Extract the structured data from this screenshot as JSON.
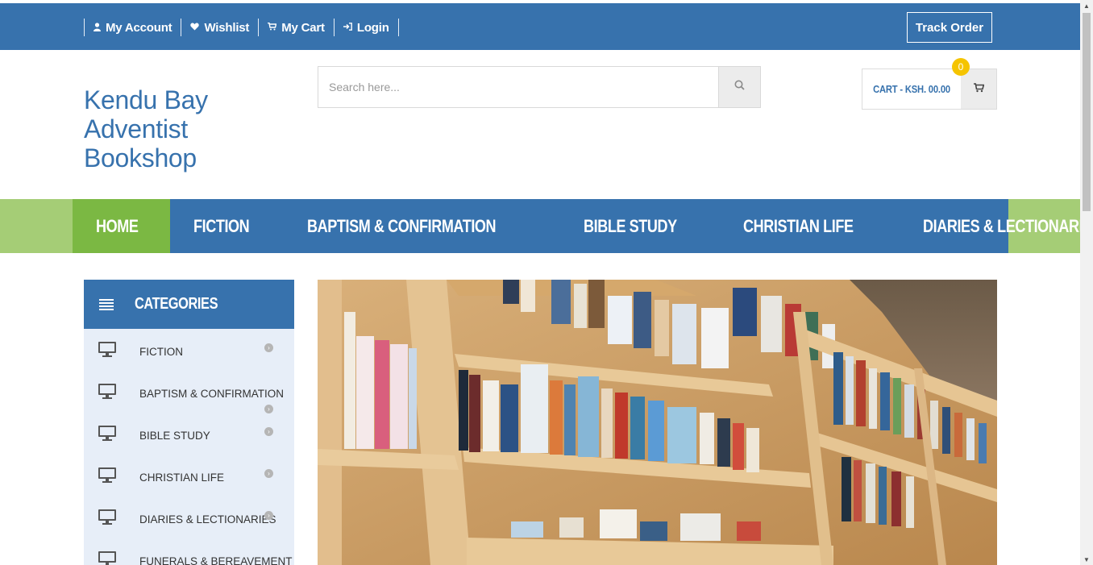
{
  "topbar": {
    "links": [
      {
        "icon": "user-icon",
        "label": "My Account"
      },
      {
        "icon": "heart-icon",
        "label": "Wishlist"
      },
      {
        "icon": "cart-icon",
        "label": "My Cart"
      },
      {
        "icon": "login-icon",
        "label": "Login"
      }
    ],
    "track_order": "Track Order"
  },
  "logo": {
    "line1": "Kendu Bay",
    "line2": "Adventist",
    "line3": "Bookshop"
  },
  "search": {
    "placeholder": "Search here..."
  },
  "cart": {
    "label": "CART - KSH. 00.00",
    "count": "0"
  },
  "nav": {
    "items": [
      "HOME",
      "FICTION",
      "BAPTISM & CONFIRMATION",
      "BIBLE STUDY",
      "CHRISTIAN LIFE",
      "DIARIES & LECTIONARIES"
    ],
    "active": "HOME"
  },
  "categories": {
    "title": "CATEGORIES",
    "items": [
      "FICTION",
      "BAPTISM & CONFIRMATION",
      "BIBLE STUDY",
      "CHRISTIAN LIFE",
      "DIARIES & LECTIONARIES",
      "FUNERALS & BEREAVEMENT"
    ]
  },
  "hero": {
    "image": "bookshelf-photo"
  },
  "colors": {
    "primary": "#3772ad",
    "accent_green": "#7bb843",
    "light_green": "#a5cd76",
    "badge": "#f5c400",
    "sidebar_bg": "#e7eef8"
  }
}
